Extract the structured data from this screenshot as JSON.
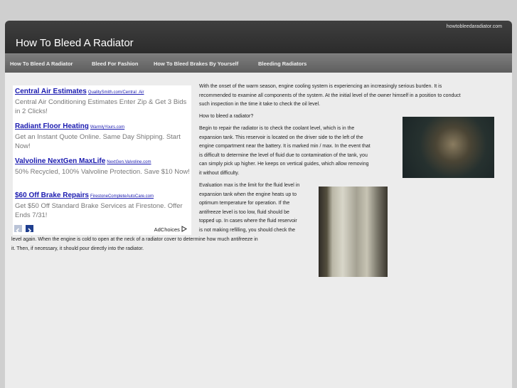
{
  "header": {
    "domain": "howtobleedaradiator.com",
    "title": "How To Bleed A Radiator"
  },
  "nav": [
    {
      "label": "How To Bleed A Radiator"
    },
    {
      "label": "Bleed For Fashion"
    },
    {
      "label": "How To Bleed Brakes By Yourself"
    },
    {
      "label": "Bleeding Radiators"
    }
  ],
  "ads": [
    {
      "headline": "Central Air Estimates",
      "url": "QualitySmith.com/Central_Air",
      "desc": "Central Air Conditioning Estimates Enter Zip & Get 3 Bids in 2 Clicks!"
    },
    {
      "headline": "Radiant Floor Heating",
      "url": "WarmlyYours.com",
      "desc": "Get an Instant Quote Online. Same Day Shipping. Start Now!"
    },
    {
      "headline": "Valvoline NextGen MaxLife",
      "url": "NextGen.Valvoline.com",
      "desc": "50% Recycled, 100% Valvoline Protection. Save $10 Now!"
    },
    {
      "headline": "$60 Off Brake Repairs",
      "url": "FirestoneCompleteAutoCare.com",
      "desc": "Get $50 Off Standard Brake Services at Firestone. Offer Ends 7/31!"
    }
  ],
  "adchoices": "AdChoices",
  "article": {
    "intro_lines": [
      "With the onset of the warm season, engine cooling system is experiencing an increasingly serious burden.  It is",
      "recommended to examine all components of the system. At the initial level of the owner himself in a position to conduct",
      "such inspection in the time it take to check the oil level."
    ],
    "question": "How to bleed a radiator?",
    "para2_lines": [
      "Begin to repair the radiator is to check the coolant level, which is in the",
      "expansion tank. This reservoir is located on the driver side to the left of the",
      "engine compartment near the battery. It is marked min / max. In the event that",
      "is difficult to determine the level of fluid due to contamination of the tank, you",
      "can simply pick up higher. He keeps on vertical guides, which allow removing",
      "it without difficulty."
    ],
    "para3_lines": [
      "Evaluation max is the limit for the fluid level in",
      "expansion tank when the engine heats up to",
      "optimum temperature for operation. If the",
      "antifreeze level is too low, fluid should be",
      "topped up. In cases where the fluid reservoir",
      "is not making refilling, you should check the"
    ],
    "para4_lines": [
      "level again. When the engine is cold to open at the neck of a radiator cover to determine how much antifreeze in",
      "it. Then, if necessary, it should pour directly into the radiator."
    ]
  }
}
